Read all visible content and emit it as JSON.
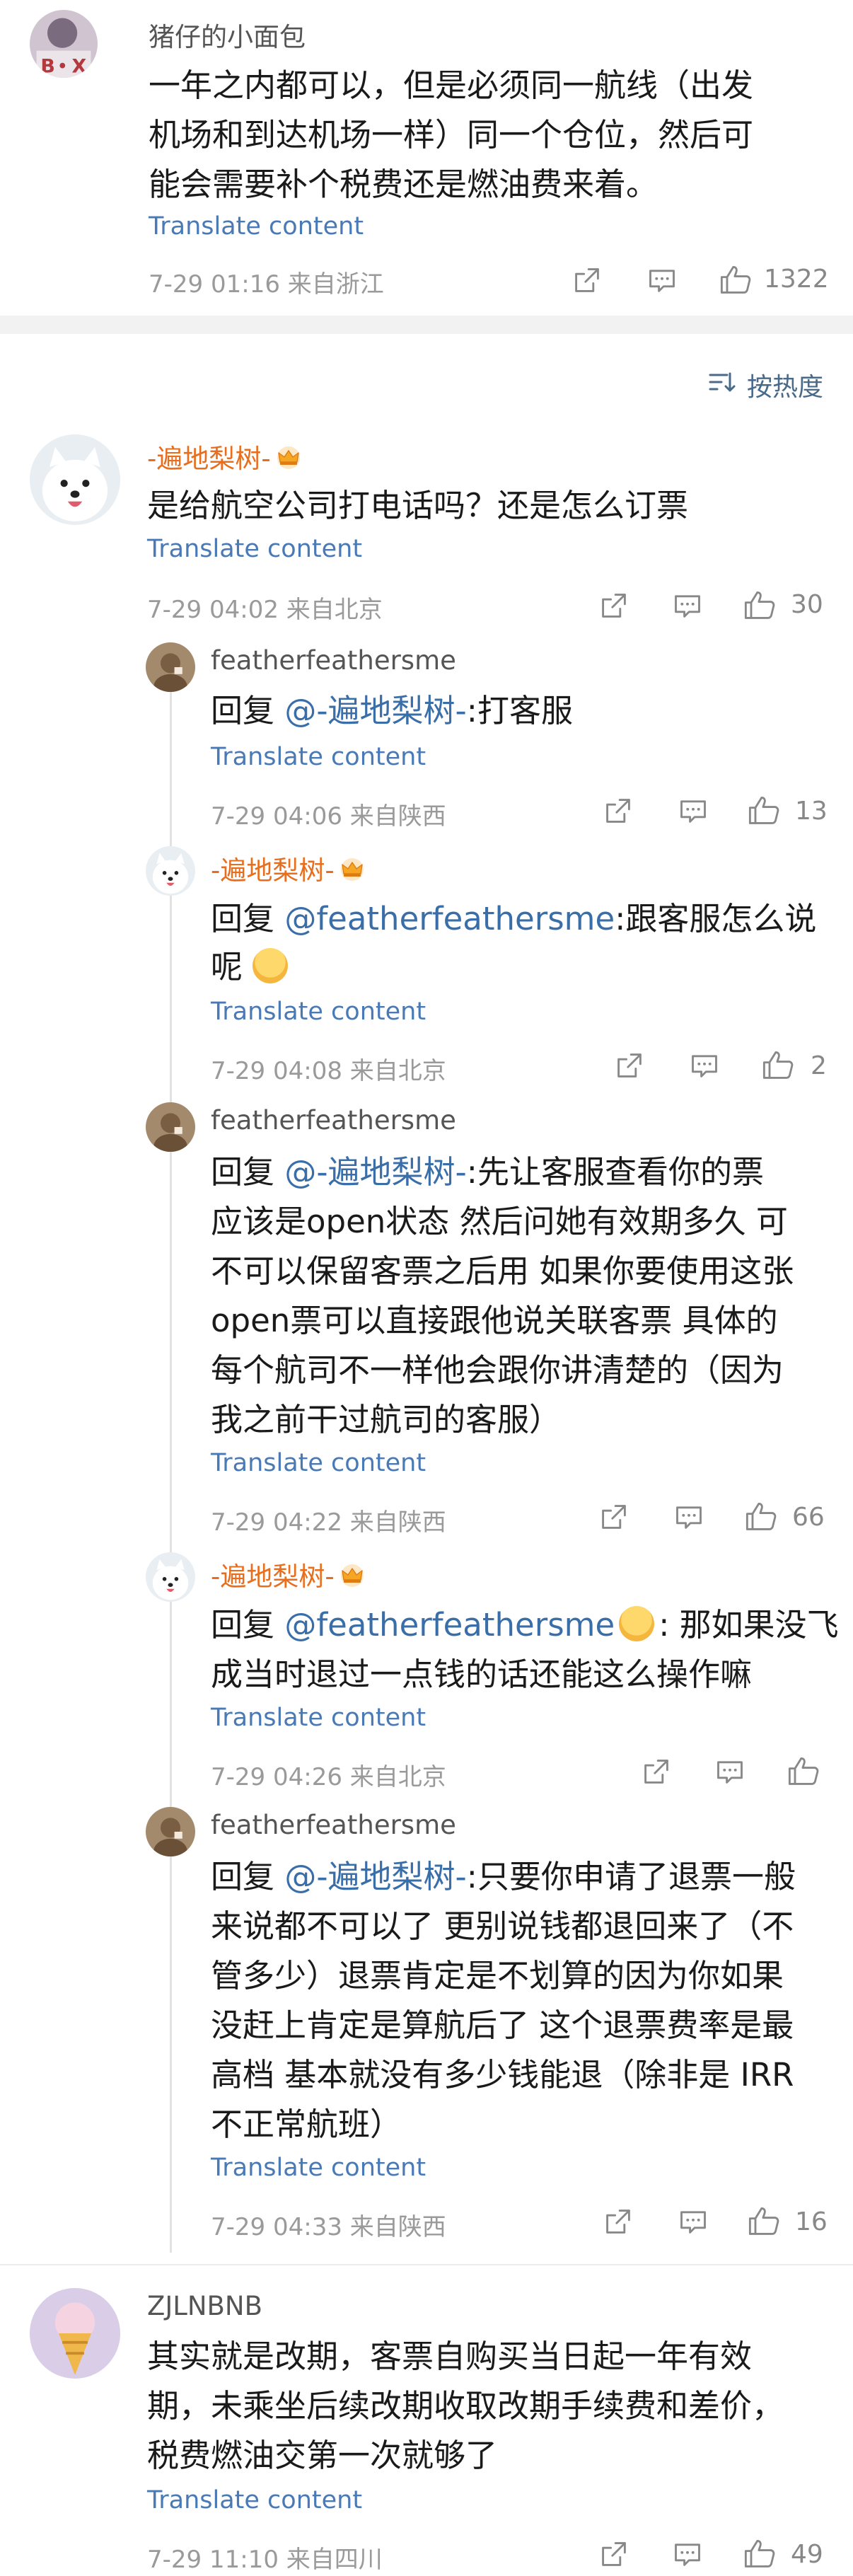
{
  "top": {
    "name": "猪仔的小面包",
    "lines": [
      "一年之内都可以，但是必须同一航线（出发",
      "机场和到达机场一样）同一个仓位，然后可",
      "能会需要补个税费还是燃油费来着。"
    ],
    "translate": "Translate content",
    "meta": "7-29 01:16  来自浙江",
    "likes": "1322"
  },
  "sort_label": "按热度",
  "main": {
    "name": "-遍地梨树-",
    "text": "是给航空公司打电话吗？还是怎么订票",
    "translate": "Translate content",
    "meta": "7-29 04:02  来自北京",
    "likes": "30"
  },
  "replies": [
    {
      "name": "featherfeathersme",
      "prefix": "回复 ",
      "mention": "@-遍地梨树-",
      "lines": [
        ":打客服"
      ],
      "translate": "Translate content",
      "meta": "7-29 04:06  来自陕西",
      "likes": "13"
    },
    {
      "name": "-遍地梨树-",
      "prefix": "回复 ",
      "mention": "@featherfeathersme",
      "lines": [
        ":跟客服怎么说",
        "呢"
      ],
      "translate": "Translate content",
      "meta": "7-29 04:08  来自北京",
      "likes": "2"
    },
    {
      "name": "featherfeathersme",
      "prefix": "回复 ",
      "mention": "@-遍地梨树-",
      "lines": [
        ":先让客服查看你的票",
        "应该是open状态 然后问她有效期多久 可",
        "不可以保留客票之后用 如果你要使用这张",
        "open票可以直接跟他说关联客票 具体的",
        "每个航司不一样他会跟你讲清楚的（因为",
        "我之前干过航司的客服）"
      ],
      "translate": "Translate content",
      "meta": "7-29 04:22  来自陕西",
      "likes": "66"
    },
    {
      "name": "-遍地梨树-",
      "prefix": "回复 ",
      "mention": "@featherfeathersme",
      "lines": [
        ": 那如果没飞",
        "成当时退过一点钱的话还能这么操作嘛"
      ],
      "translate": "Translate content",
      "meta": "7-29 04:26  来自北京",
      "likes": ""
    },
    {
      "name": "featherfeathersme",
      "prefix": "回复 ",
      "mention": "@-遍地梨树-",
      "lines": [
        ":只要你申请了退票一般",
        "来说都不可以了 更别说钱都退回来了（不",
        "管多少）退票肯定是不划算的因为你如果",
        "没赶上肯定是算航后了 这个退票费率是最",
        "高档 基本就没有多少钱能退（除非是 IRR",
        "不正常航班）"
      ],
      "translate": "Translate content",
      "meta": "7-29 04:33  来自陕西",
      "likes": "16"
    }
  ],
  "last": {
    "name": "ZJLNBNB",
    "lines": [
      "其实就是改期，客票自购买当日起一年有效",
      "期，未乘坐后续改期收取改期手续费和差价，",
      "税费燃油交第一次就够了"
    ],
    "translate": "Translate content",
    "meta": "7-29 11:10  来自四川",
    "likes": "49"
  },
  "colors": {
    "mention": "#3a6ea8",
    "orange_name": "#e86e1d",
    "translate": "#4a7ab5",
    "meta": "#9a9a9a"
  },
  "icons": [
    "share-icon",
    "comment-icon",
    "like-icon",
    "sort-icon",
    "crown-icon",
    "emoji-icon"
  ]
}
